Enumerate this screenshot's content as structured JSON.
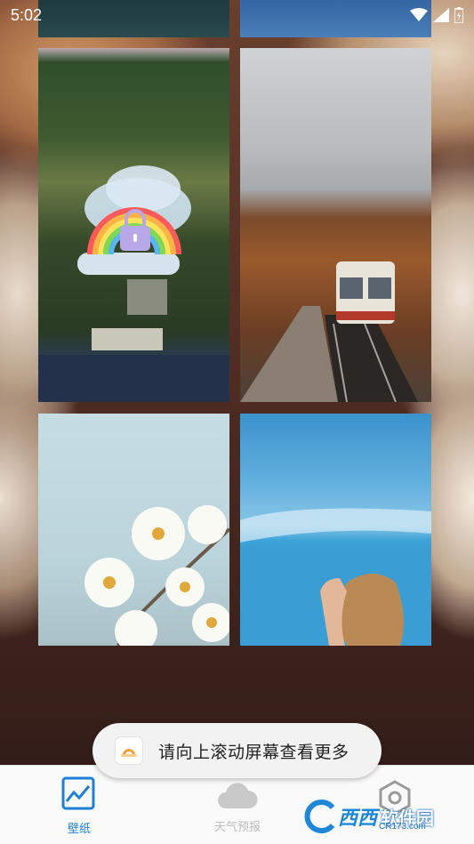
{
  "status_bar": {
    "time": "5:02"
  },
  "toast": {
    "message": "请向上滚动屏幕查看更多"
  },
  "bottom_nav": {
    "items": [
      {
        "label": "壁纸",
        "icon": "image-icon",
        "active": true
      },
      {
        "label": "天气预报",
        "icon": "cloud-icon",
        "active": false
      },
      {
        "label": "",
        "icon": "gear-icon",
        "active": false
      }
    ]
  },
  "watermark": {
    "brand": "西西",
    "name": "软件园",
    "domain": "CR173.com"
  },
  "colors": {
    "accent": "#1e7fd6",
    "inactive": "#bdbdbd",
    "toast_bg": "#f2f2f2"
  }
}
